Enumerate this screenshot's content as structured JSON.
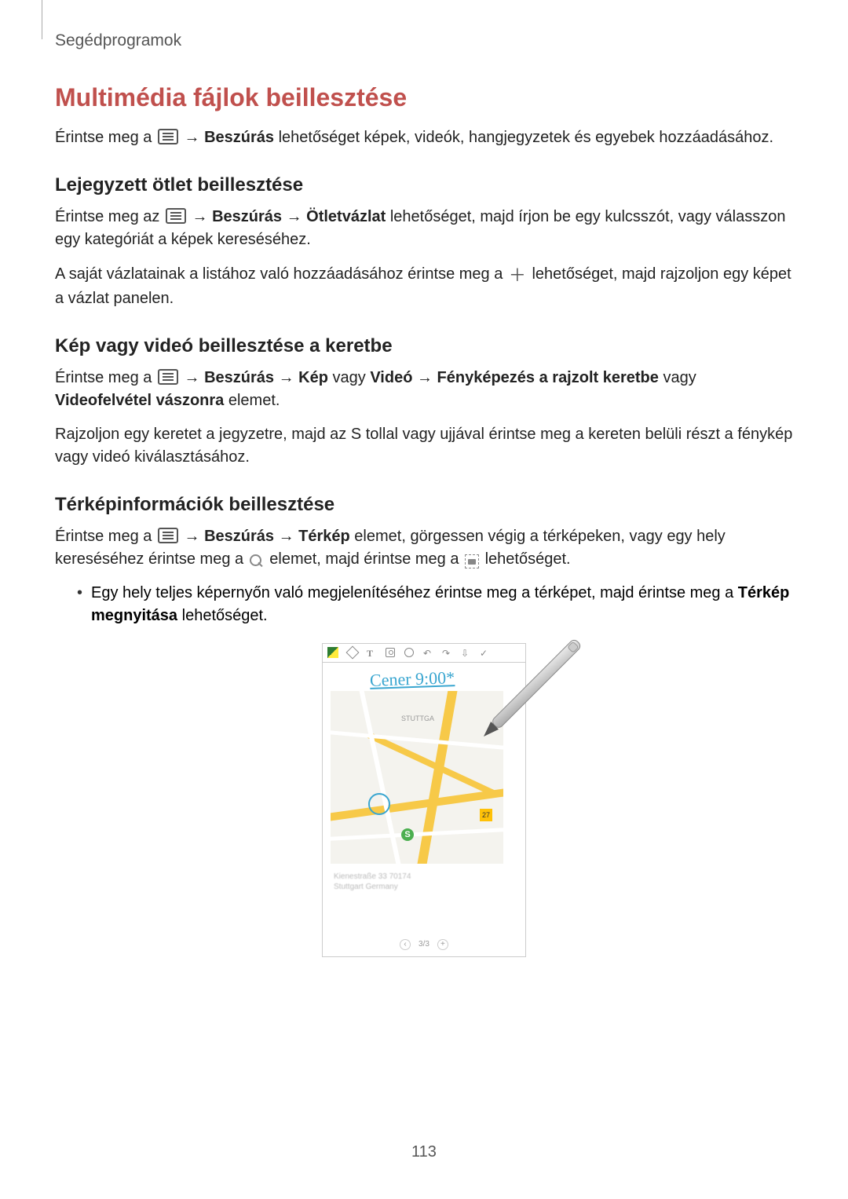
{
  "header": {
    "section": "Segédprogramok"
  },
  "h1": "Multimédia fájlok beillesztése",
  "p1": {
    "pre": "Érintse meg a ",
    "arrow": " → ",
    "b1": "Beszúrás",
    "post": " lehetőséget képek, videók, hangjegyzetek és egyebek hozzáadásához."
  },
  "s1": {
    "h2": "Lejegyzett ötlet beillesztése",
    "p1": {
      "pre": "Érintse meg az ",
      "arrow1": " → ",
      "b1": "Beszúrás",
      "arrow2": " → ",
      "b2": "Ötletvázlat",
      "post": " lehetőséget, majd írjon be egy kulcsszót, vagy válasszon egy kategóriát a képek kereséséhez."
    },
    "p2": {
      "pre": "A saját vázlatainak a listához való hozzáadásához érintse meg a ",
      "post": " lehetőséget, majd rajzoljon egy képet a vázlat panelen."
    }
  },
  "s2": {
    "h2": "Kép vagy videó beillesztése a keretbe",
    "p1": {
      "pre": "Érintse meg a ",
      "arrow1": " → ",
      "b1": "Beszúrás",
      "arrow2": " → ",
      "b2": "Kép",
      "mid1": " vagy ",
      "b3": "Videó",
      "arrow3": " → ",
      "b4": "Fényképezés a rajzolt keretbe",
      "mid2": " vagy ",
      "b5": "Videofelvétel vászonra",
      "post": " elemet."
    },
    "p2": "Rajzoljon egy keretet a jegyzetre, majd az S tollal vagy ujjával érintse meg a kereten belüli részt a fénykép vagy videó kiválasztásához."
  },
  "s3": {
    "h2": "Térképinformációk beillesztése",
    "p1": {
      "pre": "Érintse meg a ",
      "arrow1": " → ",
      "b1": "Beszúrás",
      "arrow2": " → ",
      "b2": "Térkép",
      "mid": " elemet, görgessen végig a térképeken, vagy egy hely kereséséhez érintse meg a ",
      "mid2": " elemet, majd érintse meg a ",
      "post": " lehetőséget."
    },
    "li1": {
      "pre": "Egy hely teljes képernyőn való megjelenítéséhez érintse meg a térképet, majd érintse meg a ",
      "b1": "Térkép megnyitása",
      "post": " lehetőséget."
    }
  },
  "figure": {
    "toolbar_t": "T",
    "handwriting": "Cener 9:00*",
    "map_label": "STUTTGA",
    "map_s": "S",
    "map_badge": "27",
    "address_line1": "Kienestraße 33 70174",
    "address_line2": "Stuttgart Germany",
    "pager_prev": "‹",
    "pager_text": "3/3",
    "pager_next": "+"
  },
  "page_number": "113"
}
